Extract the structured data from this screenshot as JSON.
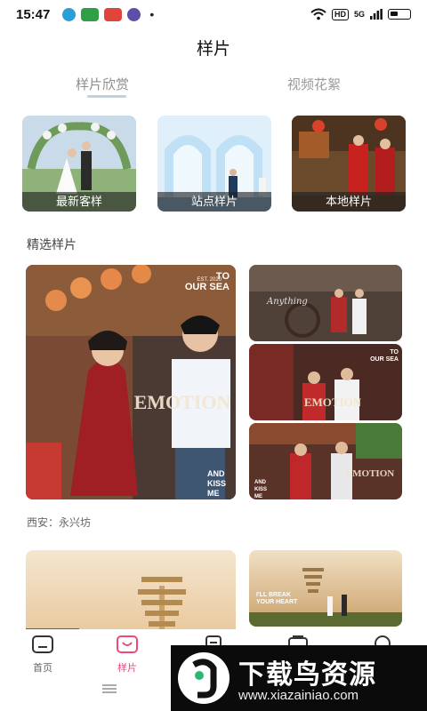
{
  "status_bar": {
    "time": "15:47",
    "signal": "5G",
    "hd": "HD"
  },
  "header": {
    "title": "样片"
  },
  "tabs": [
    {
      "label": "样片欣赏",
      "active": true
    },
    {
      "label": "视频花絮",
      "active": false
    }
  ],
  "categories": [
    {
      "label": "最新客样"
    },
    {
      "label": "站点样片"
    },
    {
      "label": "本地样片"
    }
  ],
  "featured": {
    "section_title": "精选样片",
    "photo_texts": {
      "to_our_sea": "TO\nOUR SEA",
      "emotion": "EMOTION",
      "and_kiss_me": "AND\nKISS\nME",
      "break_heart": "I'LL BREAK\nYOUR HEART"
    },
    "caption": "西安：永兴坊"
  },
  "bottom_nav": [
    {
      "label": "首页",
      "icon": "home-icon",
      "active": false
    },
    {
      "label": "样片",
      "icon": "bag-icon",
      "active": true
    },
    {
      "label": "",
      "icon": "document-icon",
      "active": false
    },
    {
      "label": "",
      "icon": "album-icon",
      "active": false
    },
    {
      "label": "",
      "icon": "profile-icon",
      "active": false
    }
  ],
  "watermark": {
    "title": "下载鸟资源",
    "url": "www.xiazainiao.com"
  },
  "colors": {
    "accent": "#f0487a",
    "tab_indicator": "#b9d2e6"
  }
}
